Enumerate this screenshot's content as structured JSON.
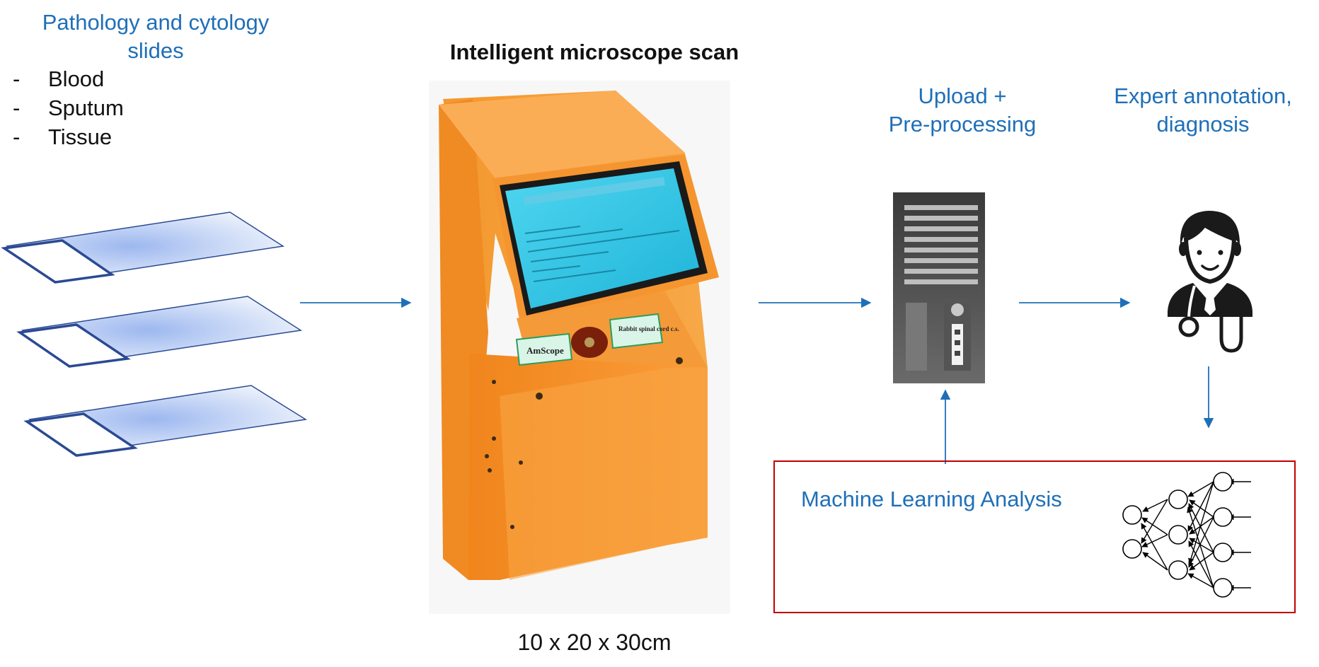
{
  "slides": {
    "title_line1": "Pathology and cytology",
    "title_line2": "slides",
    "items": [
      {
        "dash": "-",
        "label": "Blood"
      },
      {
        "dash": "-",
        "label": "Sputum"
      },
      {
        "dash": "-",
        "label": "Tissue"
      }
    ]
  },
  "microscope": {
    "title": "Intelligent microscope scan",
    "dimensions": "10 x 20 x 30cm",
    "device_label_left": "AmScope",
    "device_label_right": "Rabbit spinal cord c.s."
  },
  "upload": {
    "line1": "Upload +",
    "line2": "Pre-processing"
  },
  "expert": {
    "line1": "Expert annotation,",
    "line2": "diagnosis"
  },
  "ml": {
    "label": "Machine Learning Analysis"
  },
  "colors": {
    "accent_blue": "#1f6fb8",
    "box_red": "#c00000",
    "device_orange": "#f7922a",
    "screen_cyan": "#29c4e6"
  }
}
